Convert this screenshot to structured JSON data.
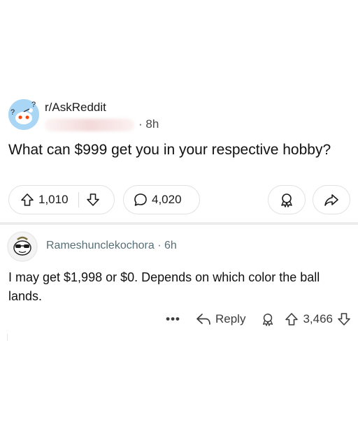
{
  "post": {
    "subreddit": "r/AskReddit",
    "age": "· 8h",
    "title": "What can $999 get you in your respective hobby?",
    "upvotes": "1,010",
    "comments": "4,020",
    "icons": {
      "subreddit_avatar": "reddit-alien-question-icon",
      "upvote": "arrow-up-icon",
      "downvote": "arrow-down-icon",
      "comment": "speech-bubble-icon",
      "award": "award-icon",
      "share": "share-arrow-icon"
    }
  },
  "comment": {
    "author": "Rameshunclekochora",
    "age": "· 6h",
    "body": "I may get $1,998 or $0. Depends on which color the ball lands.",
    "more_label": "•••",
    "reply_label": "Reply",
    "votes": "3,466",
    "icons": {
      "avatar": "snoo-avatar-icon",
      "reply": "reply-arrow-icon",
      "award": "award-icon",
      "upvote": "arrow-up-icon",
      "downvote": "arrow-down-icon"
    }
  },
  "colors": {
    "meta_text": "#576f76",
    "border": "#e2e2e2",
    "separator": "#ececec"
  }
}
